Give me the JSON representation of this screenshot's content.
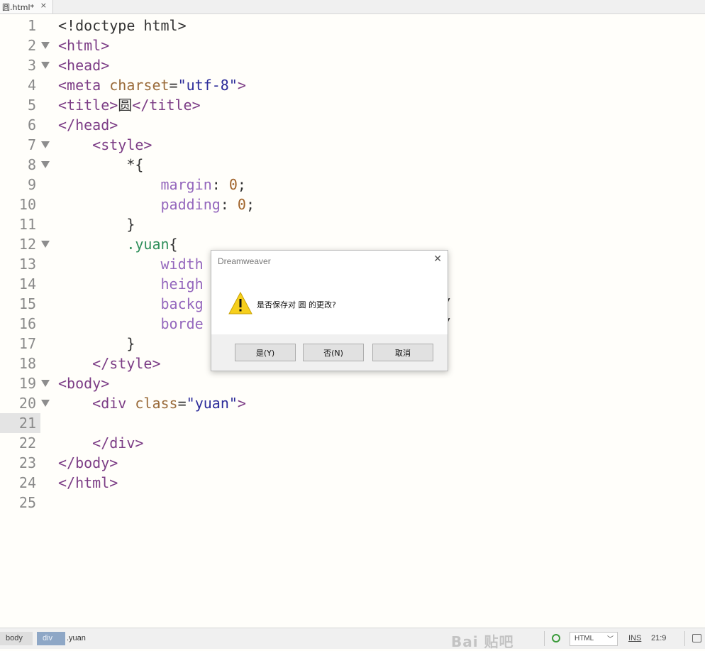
{
  "tab": {
    "label": "圆.html*",
    "close": "×"
  },
  "editor": {
    "current_line": 21,
    "lines": [
      {
        "num": "1",
        "tokens": [
          [
            "d",
            "<!doctype html>"
          ]
        ]
      },
      {
        "num": "2",
        "fold": true,
        "tokens": [
          [
            "t",
            "<html>"
          ]
        ]
      },
      {
        "num": "3",
        "fold": true,
        "tokens": [
          [
            "t",
            "<head>"
          ]
        ]
      },
      {
        "num": "4",
        "tokens": [
          [
            "t",
            "<meta "
          ],
          [
            "a",
            "charset"
          ],
          [
            "d",
            "="
          ],
          [
            "s",
            "\"utf-8\""
          ],
          [
            "t",
            ">"
          ]
        ]
      },
      {
        "num": "5",
        "tokens": [
          [
            "t",
            "<title>"
          ],
          [
            "d",
            "圆"
          ],
          [
            "t",
            "</title>"
          ]
        ]
      },
      {
        "num": "6",
        "tokens": [
          [
            "t",
            "</head>"
          ]
        ]
      },
      {
        "num": "7",
        "fold": true,
        "tokens": [
          [
            "d",
            "    "
          ],
          [
            "t",
            "<style>"
          ]
        ]
      },
      {
        "num": "8",
        "fold": true,
        "tokens": [
          [
            "d",
            "        *{"
          ]
        ]
      },
      {
        "num": "9",
        "tokens": [
          [
            "d",
            "            "
          ],
          [
            "p",
            "margin"
          ],
          [
            "d",
            ": "
          ],
          [
            "n",
            "0"
          ],
          [
            "d",
            ";"
          ]
        ]
      },
      {
        "num": "10",
        "tokens": [
          [
            "d",
            "            "
          ],
          [
            "p",
            "padding"
          ],
          [
            "d",
            ": "
          ],
          [
            "n",
            "0"
          ],
          [
            "d",
            ";"
          ]
        ]
      },
      {
        "num": "11",
        "tokens": [
          [
            "d",
            "        }"
          ]
        ]
      },
      {
        "num": "12",
        "fold": true,
        "tokens": [
          [
            "d",
            "        "
          ],
          [
            "sel",
            ".yuan"
          ],
          [
            "d",
            "{"
          ]
        ]
      },
      {
        "num": "13",
        "tokens": [
          [
            "d",
            "            "
          ],
          [
            "p",
            "width"
          ]
        ]
      },
      {
        "num": "14",
        "tokens": [
          [
            "d",
            "            "
          ],
          [
            "p",
            "heigh"
          ]
        ]
      },
      {
        "num": "15",
        "tokens": [
          [
            "d",
            "            "
          ],
          [
            "p",
            "backg"
          ],
          [
            "d",
            "                           */"
          ]
        ]
      },
      {
        "num": "16",
        "tokens": [
          [
            "d",
            "            "
          ],
          [
            "p",
            "borde"
          ],
          [
            "d",
            "                           */"
          ]
        ]
      },
      {
        "num": "17",
        "tokens": [
          [
            "d",
            "        }"
          ]
        ]
      },
      {
        "num": "18",
        "tokens": [
          [
            "d",
            "    "
          ],
          [
            "t",
            "</style>"
          ]
        ]
      },
      {
        "num": "19",
        "fold": true,
        "tokens": [
          [
            "t",
            "<body>"
          ]
        ]
      },
      {
        "num": "20",
        "fold": true,
        "tokens": [
          [
            "d",
            "    "
          ],
          [
            "t",
            "<div "
          ],
          [
            "a",
            "class"
          ],
          [
            "d",
            "="
          ],
          [
            "s",
            "\"yuan\""
          ],
          [
            "t",
            ">"
          ]
        ]
      },
      {
        "num": "21",
        "tokens": []
      },
      {
        "num": "22",
        "tokens": [
          [
            "d",
            "    "
          ],
          [
            "t",
            "</div>"
          ]
        ]
      },
      {
        "num": "23",
        "tokens": [
          [
            "t",
            "</body>"
          ]
        ]
      },
      {
        "num": "24",
        "tokens": [
          [
            "t",
            "</html>"
          ]
        ]
      },
      {
        "num": "25",
        "tokens": []
      }
    ]
  },
  "dialog": {
    "title": "Dreamweaver",
    "close": "✕",
    "message": "是否保存对 圆 的更改?",
    "icon": "warning-icon",
    "buttons": {
      "yes": "是(Y)",
      "no": "否(N)",
      "cancel": "取消"
    }
  },
  "statusbar": {
    "crumbs": [
      "body",
      "div",
      ".yuan"
    ],
    "watermark": "Bai 贴吧",
    "doc_type": "HTML",
    "insert_mode": "INS",
    "position": "21:9"
  },
  "colors": {
    "tag": "#7c3d86",
    "attr": "#9a6b3a",
    "string": "#2c2c9a",
    "property": "#9467bd",
    "number": "#a0632a",
    "selector": "#2f8f5b",
    "crumb_active": "#8ea7c6"
  }
}
